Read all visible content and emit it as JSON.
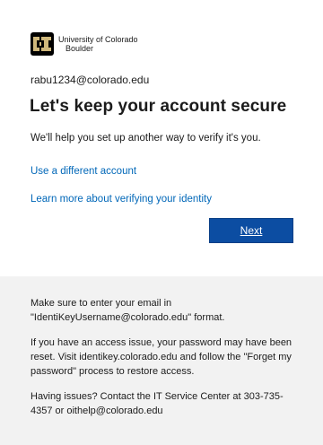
{
  "org": {
    "name_line1": "University of Colorado",
    "name_line2": "Boulder",
    "brand_gold": "#cfb87c",
    "brand_black": "#000000",
    "logo_icon": "cu-buffalo-logo"
  },
  "account": {
    "identity": "rabu1234@colorado.edu"
  },
  "page": {
    "title": "Let's keep your account secure",
    "description": "We'll help you set up another way to verify it's you."
  },
  "links": {
    "different_account": "Use a different account",
    "learn_more": "Learn more about verifying your identity"
  },
  "actions": {
    "next_label": "Next",
    "accent": "#0c4da2"
  },
  "footer": {
    "p1": "Make sure to enter your email in \"IdentiKeyUsername@colorado.edu\" format.",
    "p2": "If you have an access issue, your password may have been reset. Visit identikey.colorado.edu and follow the \"Forget my password\" process to restore access.",
    "p3": "Having issues? Contact the IT Service Center at 303-735-4357 or oithelp@colorado.edu"
  }
}
